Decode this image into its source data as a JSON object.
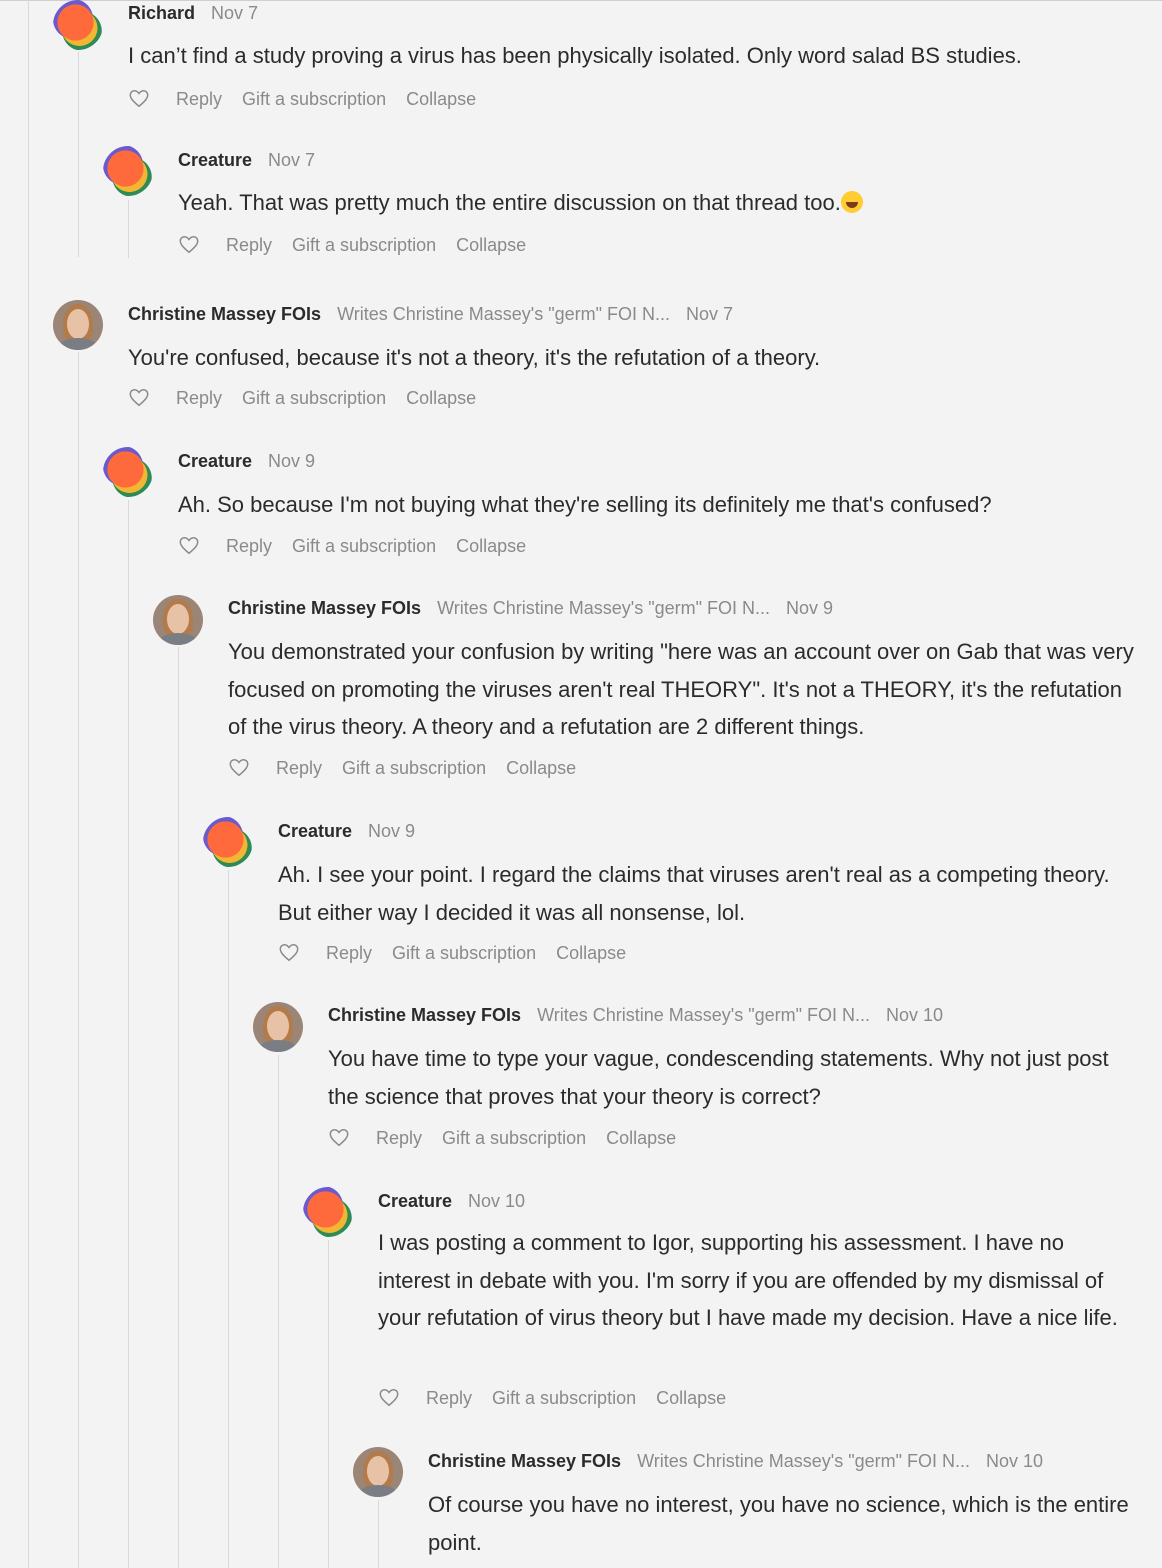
{
  "comments": [
    {
      "author": "Richard",
      "date": "Nov 7",
      "byline": "",
      "avatar": "creature-avatar",
      "text": "I can’t find a study proving a virus has been physically isolated. Only word salad BS studies."
    },
    {
      "author": "Creature",
      "date": "Nov 7",
      "byline": "",
      "avatar": "creature-avatar",
      "text": "Yeah. That was pretty much the entire discussion on that thread too."
    },
    {
      "author": "Christine Massey FOIs",
      "date": "Nov 7",
      "byline": "Writes Christine Massey's \"germ\" FOI N...",
      "avatar": "christine-avatar",
      "text": "You're confused, because it's not a theory, it's the refutation of a theory."
    },
    {
      "author": "Creature",
      "date": "Nov 9",
      "byline": "",
      "avatar": "creature-avatar",
      "text": "Ah. So because I'm not buying what they're selling its definitely me that's confused?"
    },
    {
      "author": "Christine Massey FOIs",
      "date": "Nov 9",
      "byline": "Writes Christine Massey's \"germ\" FOI N...",
      "avatar": "christine-avatar",
      "text": "You demonstrated your confusion by writing \"here was an account over on Gab that was very focused on promoting the viruses aren't real THEORY\". It's not a THEORY, it's the refutation of the virus theory. A theory and a refutation are 2 different things."
    },
    {
      "author": "Creature",
      "date": "Nov 9",
      "byline": "",
      "avatar": "creature-avatar",
      "text": "Ah. I see your point. I regard the claims that viruses aren't real as a competing theory. But either way I decided it was all nonsense, lol."
    },
    {
      "author": "Christine Massey FOIs",
      "date": "Nov 10",
      "byline": "Writes Christine Massey's \"germ\" FOI N...",
      "avatar": "christine-avatar",
      "text": "You have time to type your vague, condescending statements. Why not just post the science that proves that your theory is correct?"
    },
    {
      "author": "Creature",
      "date": "Nov 10",
      "byline": "",
      "avatar": "creature-avatar",
      "text": "I was posting a comment to Igor, supporting his assessment. I have no interest in debate with you. I'm sorry if you are offended by my dismissal of your refutation of virus theory but I have made my decision. Have a nice life."
    },
    {
      "author": "Christine Massey FOIs",
      "date": "Nov 10",
      "byline": "Writes Christine Massey's \"germ\" FOI N...",
      "avatar": "christine-avatar",
      "text": "Of course you have no interest, you have no science, which is the entire point."
    }
  ],
  "actions": {
    "reply": "Reply",
    "gift": "Gift a subscription",
    "collapse": "Collapse",
    "like_icon": "heart-icon"
  },
  "colors": {
    "background": "#f3f3f3",
    "text": "#2b2b2b",
    "muted": "#8a8a8a",
    "thread_line": "#d9d9d9"
  }
}
